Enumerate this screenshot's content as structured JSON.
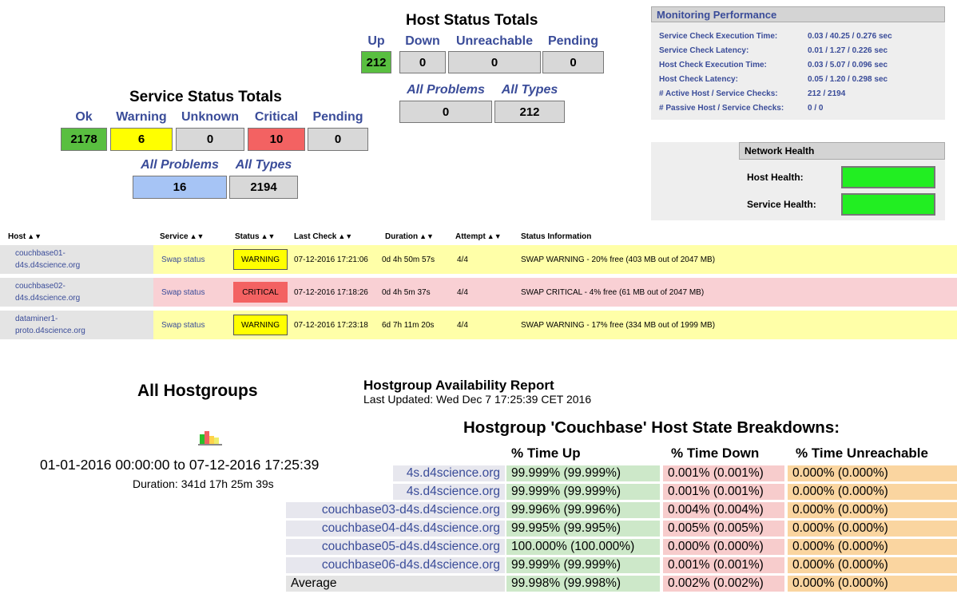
{
  "host_status": {
    "title": "Host Status Totals",
    "labels": [
      "Up",
      "Down",
      "Unreachable",
      "Pending"
    ],
    "values": [
      "212",
      "0",
      "0",
      "0"
    ],
    "problems_label": "All Problems",
    "types_label": "All Types",
    "problems_value": "0",
    "types_value": "212"
  },
  "service_status": {
    "title": "Service Status Totals",
    "labels": [
      "Ok",
      "Warning",
      "Unknown",
      "Critical",
      "Pending"
    ],
    "values": [
      "2178",
      "6",
      "0",
      "10",
      "0"
    ],
    "problems_label": "All Problems",
    "types_label": "All Types",
    "problems_value": "16",
    "types_value": "2194"
  },
  "monitoring": {
    "title": "Monitoring Performance",
    "rows": [
      {
        "label": "Service Check Execution Time:",
        "value": "0.03 / 40.25 / 0.276 sec"
      },
      {
        "label": "Service Check Latency:",
        "value": "0.01 / 1.27 / 0.226 sec"
      },
      {
        "label": "Host Check Execution Time:",
        "value": "0.03 / 5.07 / 0.096 sec"
      },
      {
        "label": "Host Check Latency:",
        "value": "0.05 / 1.20 / 0.298 sec"
      },
      {
        "label": "# Active Host / Service Checks:",
        "value": "212 / 2194"
      },
      {
        "label": "# Passive Host / Service Checks:",
        "value": "0 / 0"
      }
    ]
  },
  "network_health": {
    "title": "Network Health",
    "host_label": "Host Health:",
    "service_label": "Service Health:",
    "health_color": "#22ee22"
  },
  "service_table": {
    "headers": [
      "Host",
      "Service",
      "Status",
      "Last Check",
      "Duration",
      "Attempt",
      "Status Information"
    ],
    "sort_glyph": "▲▼",
    "rows": [
      {
        "host_line1": "couchbase01-",
        "host_line2": "d4s.d4science.org",
        "service": "Swap status",
        "status": "WARNING",
        "last_check": "07-12-2016 17:21:06",
        "duration": "0d 4h 50m 57s",
        "attempt": "4/4",
        "info": "SWAP WARNING - 20% free (403 MB out of 2047 MB)"
      },
      {
        "host_line1": "couchbase02-",
        "host_line2": "d4s.d4science.org",
        "service": "Swap status",
        "status": "CRITICAL",
        "last_check": "07-12-2016 17:18:26",
        "duration": "0d 4h 5m 37s",
        "attempt": "4/4",
        "info": "SWAP CRITICAL - 4% free (61 MB out of 2047 MB)"
      },
      {
        "host_line1": "dataminer1-",
        "host_line2": "proto.d4science.org",
        "service": "Swap status",
        "status": "WARNING",
        "last_check": "07-12-2016 17:23:18",
        "duration": "6d 7h 11m 20s",
        "attempt": "4/4",
        "info": "SWAP WARNING - 17% free (334 MB out of 1999 MB)"
      }
    ]
  },
  "hostgroups": {
    "title": "All Hostgroups",
    "range": "01-01-2016 00:00:00 to 07-12-2016 17:25:39",
    "duration": "Duration: 341d 17h 25m 39s"
  },
  "availability": {
    "title": "Hostgroup Availability Report",
    "updated": "Last Updated: Wed Dec 7 17:25:39 CET 2016",
    "breakdown_title": "Hostgroup 'Couchbase' Host State Breakdowns:",
    "headers": [
      "% Time Up",
      "% Time Down",
      "% Time Unreachable"
    ],
    "rows": [
      {
        "host": "4s.d4science.org",
        "up": "99.999% (99.999%)",
        "down": "0.001% (0.001%)",
        "unr": "0.000% (0.000%)"
      },
      {
        "host": "4s.d4science.org",
        "up": "99.999% (99.999%)",
        "down": "0.001% (0.001%)",
        "unr": "0.000% (0.000%)"
      },
      {
        "host": "couchbase03-d4s.d4science.org",
        "up": "99.996% (99.996%)",
        "down": "0.004% (0.004%)",
        "unr": "0.000% (0.000%)"
      },
      {
        "host": "couchbase04-d4s.d4science.org",
        "up": "99.995% (99.995%)",
        "down": "0.005% (0.005%)",
        "unr": "0.000% (0.000%)"
      },
      {
        "host": "couchbase05-d4s.d4science.org",
        "up": "100.000% (100.000%)",
        "down": "0.000% (0.000%)",
        "unr": "0.000% (0.000%)"
      },
      {
        "host": "couchbase06-d4s.d4science.org",
        "up": "99.999% (99.999%)",
        "down": "0.001% (0.001%)",
        "unr": "0.000% (0.000%)"
      },
      {
        "host": "Average",
        "up": "99.998% (99.998%)",
        "down": "0.002% (0.002%)",
        "unr": "0.000% (0.000%)"
      }
    ]
  }
}
